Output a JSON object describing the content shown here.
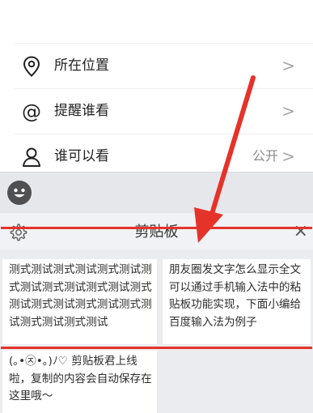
{
  "settings": {
    "location": {
      "label": "所在位置",
      "icon": "location-pin-icon"
    },
    "remind": {
      "label": "提醒谁看",
      "icon": "at-sign-icon"
    },
    "visibility": {
      "label": "谁可以看",
      "icon": "person-icon",
      "value": "公开"
    },
    "chevron": ">"
  },
  "emoji_bar": {
    "icon": "emoji-face-icon"
  },
  "keyboard": {
    "title": "剪贴板",
    "close": "×",
    "settings_icon": "gear-icon",
    "clips": [
      "测式测试测式测试测式测试测式测试测式测试测式测试测式测试测式测试测式测试测式测试测式测试测式测试",
      "朋友圈发文字怎么显示全文可以通过手机输入法中的粘贴板功能实现，下面小编给百度输入法为例子",
      "(｡•㉨•｡)ﾉ♡ 剪贴板君上线啦，复制的内容会自动保存在这里哦～"
    ]
  },
  "colors": {
    "annotation_red": "#e5332a",
    "keyboard_bg": "#ebecf0",
    "emoji_bar_bg": "#e6e7eb"
  }
}
